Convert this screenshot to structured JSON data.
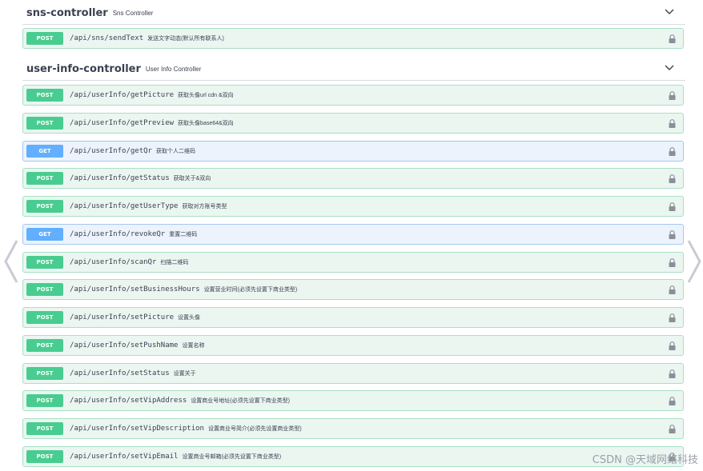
{
  "sections": [
    {
      "title": "sns-controller",
      "description": "Sns Controller",
      "operations": [
        {
          "method": "POST",
          "path": "/api/sns/sendText",
          "summary": "发送文字动态(默认所有联系人)"
        }
      ]
    },
    {
      "title": "user-info-controller",
      "description": "User Info Controller",
      "operations": [
        {
          "method": "POST",
          "path": "/api/userInfo/getPicture",
          "summary": "获取头像url cdn &双向"
        },
        {
          "method": "POST",
          "path": "/api/userInfo/getPreview",
          "summary": "获取头像base64&双向"
        },
        {
          "method": "GET",
          "path": "/api/userInfo/getQr",
          "summary": "获取个人二维码"
        },
        {
          "method": "POST",
          "path": "/api/userInfo/getStatus",
          "summary": "获取关于&双向"
        },
        {
          "method": "POST",
          "path": "/api/userInfo/getUserType",
          "summary": "获取对方账号类型"
        },
        {
          "method": "GET",
          "path": "/api/userInfo/revokeQr",
          "summary": "重置二维码"
        },
        {
          "method": "POST",
          "path": "/api/userInfo/scanQr",
          "summary": "扫描二维码"
        },
        {
          "method": "POST",
          "path": "/api/userInfo/setBusinessHours",
          "summary": "设置营业时间(必须先设置下商业类型)"
        },
        {
          "method": "POST",
          "path": "/api/userInfo/setPicture",
          "summary": "设置头像"
        },
        {
          "method": "POST",
          "path": "/api/userInfo/setPushName",
          "summary": "设置名称"
        },
        {
          "method": "POST",
          "path": "/api/userInfo/setStatus",
          "summary": "设置关于"
        },
        {
          "method": "POST",
          "path": "/api/userInfo/setVipAddress",
          "summary": "设置商业号地址(必须先设置下商业类型)"
        },
        {
          "method": "POST",
          "path": "/api/userInfo/setVipDescription",
          "summary": "设置商业号简介(必须先设置商业类型)"
        },
        {
          "method": "POST",
          "path": "/api/userInfo/setVipEmail",
          "summary": "设置商业号邮箱(必须先设置下商业类型)"
        }
      ]
    }
  ],
  "icons": {
    "chevron": "chevron-down-icon",
    "lock": "lock-icon",
    "prev": "chevron-left-icon",
    "next": "chevron-right-icon"
  },
  "colors": {
    "post": "#49cc90",
    "get": "#61affe",
    "post_bg": "#ebf6f1",
    "get_bg": "#ecf3fc"
  },
  "watermark": "CSDN @天域网络科技"
}
